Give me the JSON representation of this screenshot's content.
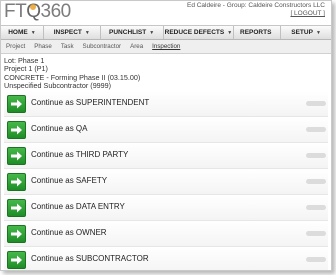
{
  "app": {
    "logo_text": "FTQ360",
    "user_line": "Ed Caldeire -  Group: Caldeire Constructors LLC",
    "logout_label": "[ LOGOUT ]"
  },
  "nav": [
    {
      "label": "HOME",
      "caret": "▼"
    },
    {
      "label": "INSPECT",
      "caret": "▼"
    },
    {
      "label": "PUNCHLIST",
      "caret": "▼"
    },
    {
      "label": "REDUCE DEFECTS",
      "caret": "▼"
    },
    {
      "label": "REPORTS",
      "caret": ""
    },
    {
      "label": "SETUP",
      "caret": "▼"
    }
  ],
  "subnav": [
    "Project",
    "Phase",
    "Task",
    "Subcontractor",
    "Area",
    "Inspection"
  ],
  "context": {
    "lot": "Lot: Phase 1",
    "project": "Project 1 (P1)",
    "task": "CONCRETE - Forming Phase II (03.15.00)",
    "subcontractor": "Unspecified Subcontractor (9999)"
  },
  "roles": [
    {
      "label": "Continue as SUPERINTENDENT"
    },
    {
      "label": "Continue as QA"
    },
    {
      "label": "Continue as THIRD PARTY"
    },
    {
      "label": "Continue as SAFETY"
    },
    {
      "label": "Continue as DATA ENTRY"
    },
    {
      "label": "Continue as OWNER"
    },
    {
      "label": "Continue as SUBCONTRACTOR"
    }
  ],
  "colors": {
    "arrow_button": "#2f9e35",
    "nav_bg": "#e6e6e6",
    "logo_accent": "#e8a12b"
  },
  "icons": {
    "row_button": "right-arrow-icon"
  }
}
